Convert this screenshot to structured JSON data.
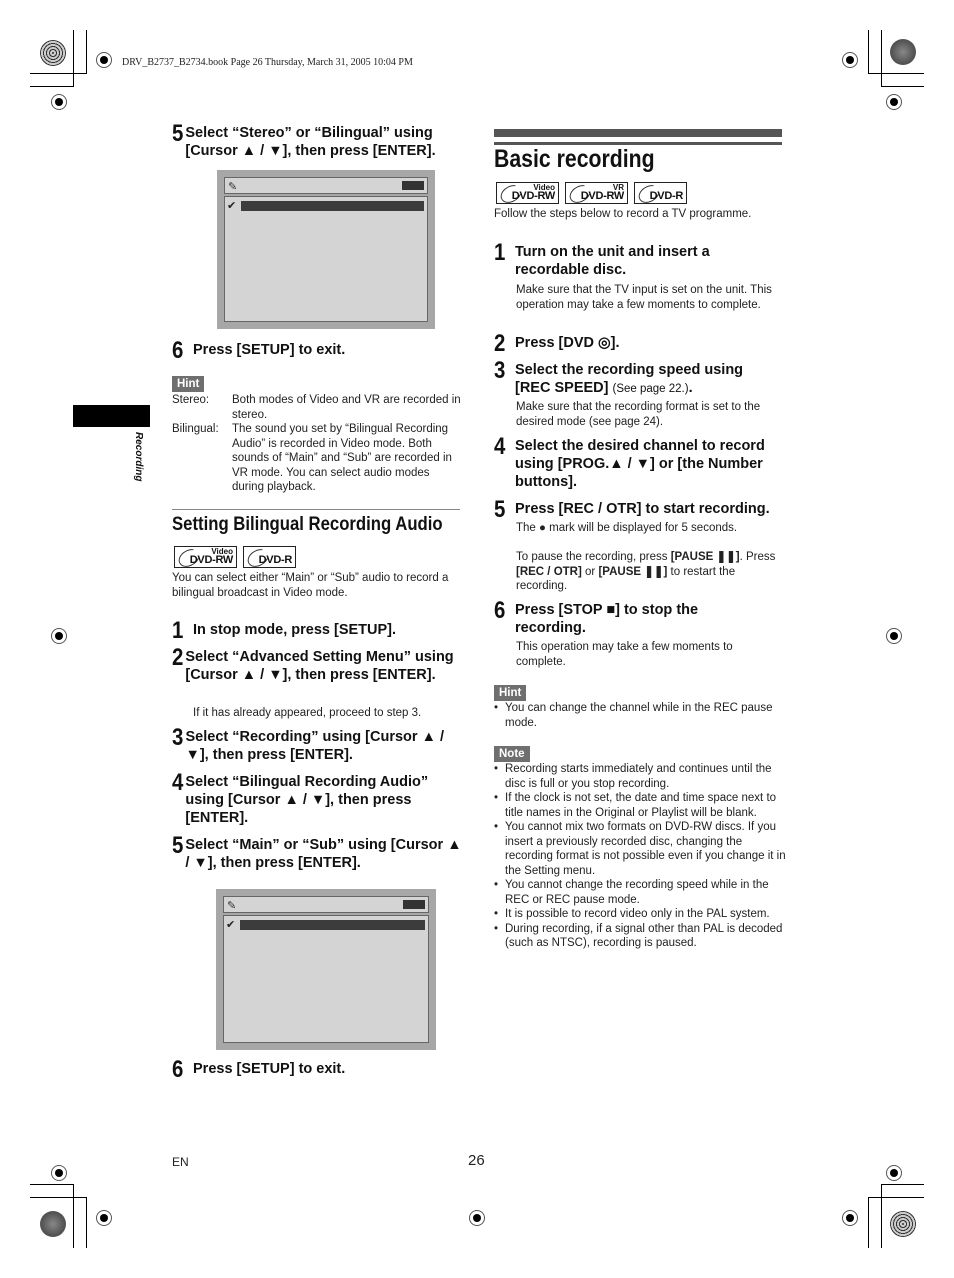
{
  "print_header": "DRV_B2737_B2734.book  Page 26  Thursday, March 31, 2005  10:04 PM",
  "side_tab": {
    "label": "Recording"
  },
  "left_column": {
    "top_steps": [
      {
        "num": "5",
        "text": "Select “Stereo” or “Bilingual” using [Cursor ▲ / ▼], then press [ENTER]."
      },
      {
        "num": "6",
        "text": "Press [SETUP] to exit."
      }
    ],
    "hint": {
      "badge": "Hint",
      "rows": [
        {
          "term": "Stereo:",
          "desc": "Both modes of Video and VR are recorded in stereo."
        },
        {
          "term": "Bilingual:",
          "desc": "The sound you set by “Bilingual Recording Audio” is recorded in Video mode. Both sounds of “Main” and “Sub” are recorded in VR mode. You can select audio modes during playback."
        }
      ]
    },
    "section": {
      "title": "Setting Bilingual Recording Audio",
      "logos": [
        {
          "sup": "Video",
          "main": "DVD-RW"
        },
        {
          "sup": "",
          "main": "DVD-R"
        }
      ],
      "intro": "You can select either “Main” or “Sub” audio to record a bilingual broadcast in Video mode.",
      "steps": [
        {
          "num": "1",
          "text": "In stop mode, press [SETUP]."
        },
        {
          "num": "2",
          "text": "Select “Advanced Setting Menu” using [Cursor ▲ / ▼], then press [ENTER].",
          "note": "If it has already appeared, proceed to step 3."
        },
        {
          "num": "3",
          "text": "Select “Recording” using [Cursor ▲ / ▼], then press [ENTER]."
        },
        {
          "num": "4",
          "text": "Select “Bilingual Recording Audio” using [Cursor ▲ / ▼], then press [ENTER]."
        },
        {
          "num": "5",
          "text": "Select “Main” or “Sub” using [Cursor ▲ / ▼], then press [ENTER]."
        },
        {
          "num": "6",
          "text": "Press [SETUP] to exit."
        }
      ]
    },
    "osd_icon": "setup-menu-icon",
    "osd_check": "✔"
  },
  "right_column": {
    "title": "Basic recording",
    "logos": [
      {
        "sup": "Video",
        "main": "DVD-RW"
      },
      {
        "sup": "VR",
        "main": "DVD-RW"
      },
      {
        "sup": "",
        "main": "DVD-R"
      }
    ],
    "intro": "Follow the steps below to record a TV programme.",
    "steps": [
      {
        "num": "1",
        "text": "Turn on the unit and insert a recordable disc.",
        "note": "Make sure that the TV input is set on the unit. This operation may take a few moments to complete."
      },
      {
        "num": "2",
        "text": "Press [DVD ◎]."
      },
      {
        "num": "3",
        "text": "Select the recording speed using [REC SPEED]",
        "aside": "(See page 22.)",
        "tail": ".",
        "note": "Make sure that the recording format is set to the desired mode (see page 24)."
      },
      {
        "num": "4",
        "text": "Select the desired channel to record using [PROG.▲ / ▼] or [the Number buttons]."
      },
      {
        "num": "5",
        "text": "Press [REC / OTR] to start recording.",
        "note": "The ● mark will be displayed for 5 seconds.",
        "note2_parts": [
          "To pause the recording, press ",
          "[PAUSE ❚❚]",
          ". Press ",
          "[REC / OTR]",
          " or ",
          "[PAUSE ❚❚]",
          " to restart the recording."
        ]
      },
      {
        "num": "6",
        "text": "Press [STOP ■] to stop the recording.",
        "note": "This operation may take a few moments to complete."
      }
    ],
    "hint": {
      "badge": "Hint",
      "items": [
        "You can change the channel while in the REC pause mode."
      ]
    },
    "note": {
      "badge": "Note",
      "items": [
        "Recording starts immediately and continues until the disc is full or you stop recording.",
        "If the clock is not set, the date and time space next to title names in the Original or Playlist will be blank.",
        "You cannot mix two formats on DVD-RW discs. If you insert a previously recorded disc, changing the recording format is not possible even if you change it in the Setting menu.",
        "You cannot change the recording speed while in the REC or REC pause mode.",
        "It is possible to record video only in the PAL system.",
        "During recording, if a signal other than PAL is decoded (such as NTSC), recording is paused."
      ]
    }
  },
  "footer": {
    "lang": "EN",
    "page": "26"
  }
}
